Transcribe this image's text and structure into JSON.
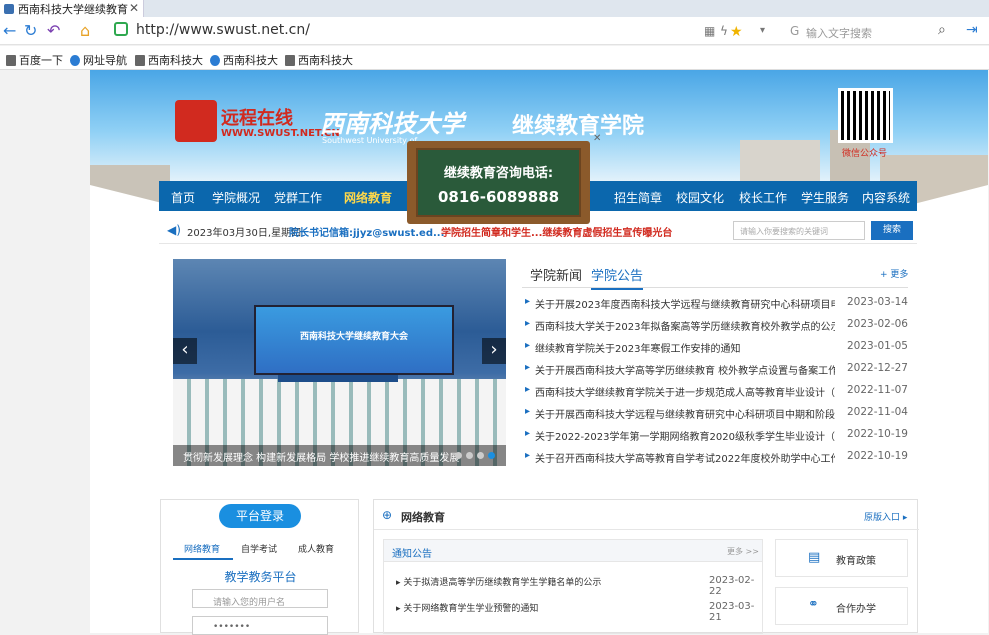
{
  "browser": {
    "tab_title": "西南科技大学继续教育",
    "tab_close": "✕",
    "url": "http://www.swust.net.cn/",
    "search_placeholder": "输入文字搜索"
  },
  "bookmarks": [
    "百度一下",
    "网址导航",
    "西南科技大",
    "西南科技大",
    "西南科技大"
  ],
  "header": {
    "logo_text": "远程在线",
    "logo_url": "WWW.SWUST.NET.CN",
    "university_cn": "西南科技大学",
    "university_en": "Southwest University of...",
    "college": "继续教育学院",
    "qr_label": "微信公众号"
  },
  "nav": [
    "首页",
    "学院概况",
    "党群工作",
    "网络教育",
    "招生简章",
    "校园文化",
    "校长工作",
    "学生服务",
    "内容系统"
  ],
  "consult": {
    "line1": "继续教育咨询电话:",
    "line2": "0816-6089888"
  },
  "info": {
    "date": "2023年03月30日,星期四",
    "email": "院长书记信箱:jjyz@swust.ed...",
    "marquee": "学院招生简章和学生...继续教育虚假招生宣传曝光台",
    "search_placeholder": "请输入你要搜索的关键词",
    "search_btn": "搜索"
  },
  "slider": {
    "screen_title": "西南科技大学继续教育大会",
    "caption": "贯彻新发展理念 构建新发展格局 学校推进继续教育高质量发展",
    "prev": "‹",
    "next": "›"
  },
  "news": {
    "tabs": [
      "学院新闻",
      "学院公告"
    ],
    "more": "+ 更多",
    "items": [
      {
        "title": "关于开展2023年度西南科技大学远程与继续教育研究中心科研项目申报...",
        "date": "2023-03-14"
      },
      {
        "title": "西南科技大学关于2023年拟备案高等学历继续教育校外教学点的公示",
        "date": "2023-02-06"
      },
      {
        "title": "继续教育学院关于2023年寒假工作安排的通知",
        "date": "2023-01-05"
      },
      {
        "title": "关于开展西南科技大学高等学历继续教育 校外教学点设置与备案工作的...",
        "date": "2022-12-27"
      },
      {
        "title": "西南科技大学继续教育学院关于进一步规范成人高等教育毕业设计（论...",
        "date": "2022-11-07"
      },
      {
        "title": "关于开展西南科技大学远程与继续教育研究中心科研项目中期和阶段检...",
        "date": "2022-11-04"
      },
      {
        "title": "关于2022-2023学年第一学期网络教育2020级秋季学生毕业设计（论文...",
        "date": "2022-10-19"
      },
      {
        "title": "关于召开西南科技大学高等教育自学考试2022年度校外助学中心工作会...",
        "date": "2022-10-19"
      }
    ]
  },
  "login": {
    "title": "平台登录",
    "tabs": [
      "网络教育",
      "自学考试",
      "成人教育"
    ],
    "platform": "教学教务平台",
    "username_ph": "请输入您的用户名",
    "password_ph": "•••••••"
  },
  "netedu": {
    "title": "网络教育",
    "entry": "原版入口 ▸",
    "notice_title": "通知公告",
    "notice_more": "更多 >>",
    "notices": [
      {
        "title": "关于拟清退高等学历继续教育学生学籍名单的公示",
        "date": "2023-02-22"
      },
      {
        "title": "关于网络教育学生学业预警的通知",
        "date": "2023-03-21"
      }
    ],
    "side": [
      "教育政策",
      "合作办学"
    ]
  }
}
